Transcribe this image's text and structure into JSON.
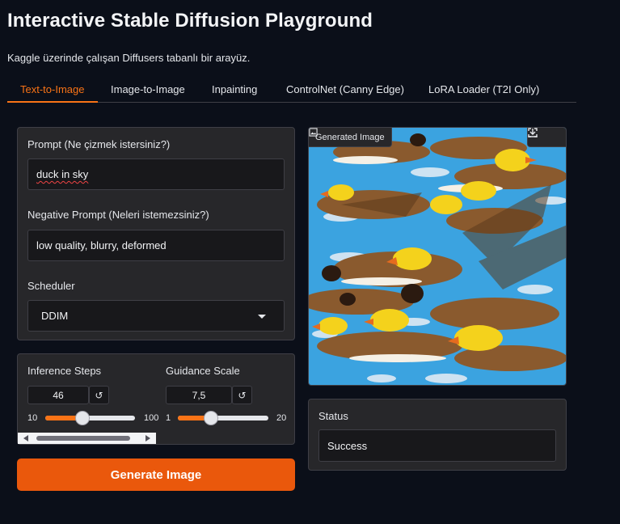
{
  "app": {
    "title": "Interactive Stable Diffusion Playground",
    "subtitle": "Kaggle üzerinde çalışan Diffusers tabanlı bir arayüz."
  },
  "tabs": [
    {
      "label": "Text-to-Image",
      "active": true
    },
    {
      "label": "Image-to-Image",
      "active": false
    },
    {
      "label": "Inpainting",
      "active": false
    },
    {
      "label": "ControlNet (Canny Edge)",
      "active": false
    },
    {
      "label": "LoRA Loader (T2I Only)",
      "active": false
    }
  ],
  "form": {
    "prompt_label": "Prompt (Ne çizmek istersiniz?)",
    "prompt_value": "duck in sky",
    "negative_label": "Negative Prompt (Neleri istemezsiniz?)",
    "negative_value": "low quality, blurry, deformed",
    "scheduler_label": "Scheduler",
    "scheduler_value": "DDIM"
  },
  "sliders": {
    "steps": {
      "label": "Inference Steps",
      "value": "46",
      "min": "10",
      "max": "100",
      "reset_icon": "↺"
    },
    "guidance": {
      "label": "Guidance Scale",
      "value": "7,5",
      "min": "1",
      "max": "20",
      "reset_icon": "↺"
    }
  },
  "generate_label": "Generate Image",
  "output": {
    "badge": "Generated Image",
    "icons": [
      "image-icon",
      "fullscreen-icon",
      "download-icon"
    ]
  },
  "status": {
    "label": "Status",
    "value": "Success"
  },
  "colors": {
    "accent": "#f97316",
    "button": "#ea580c",
    "background": "#0b0f19",
    "panel": "#27272a"
  }
}
